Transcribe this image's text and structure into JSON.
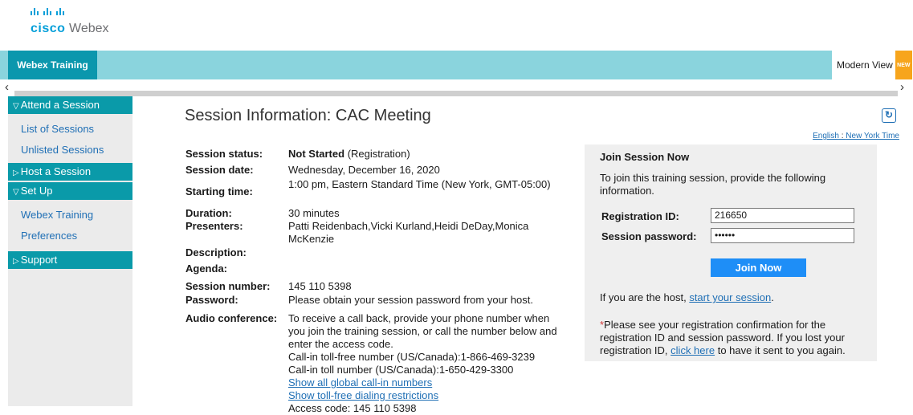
{
  "brand": {
    "cisco": "cisco",
    "webex": "Webex"
  },
  "topbar": {
    "tab": "Webex Training",
    "modern_view": "Modern View",
    "new_badge": "NEW"
  },
  "sidebar": {
    "attend": "Attend a Session",
    "list_sessions": "List of Sessions",
    "unlisted_sessions": "Unlisted Sessions",
    "host": "Host a Session",
    "setup": "Set Up",
    "webex_training": "Webex Training",
    "preferences": "Preferences",
    "support": "Support"
  },
  "page": {
    "title": "Session Information: CAC Meeting",
    "language": "English",
    "timezone": "New York Time"
  },
  "session": {
    "status_label": "Session status:",
    "status_value": "Not Started",
    "status_extra": "(Registration)",
    "date_label": "Session date:",
    "date_value": "Wednesday, December 16, 2020",
    "start_label": "Starting time:",
    "start_value": "1:00 pm, Eastern Standard Time (New York, GMT-05:00)",
    "duration_label": "Duration:",
    "duration_value": "30 minutes",
    "presenters_label": "Presenters:",
    "presenters_value": "Patti Reidenbach,Vicki Kurland,Heidi DeDay,Monica McKenzie",
    "description_label": "Description:",
    "agenda_label": "Agenda:",
    "number_label": "Session number:",
    "number_value": "145 110 5398",
    "password_label": "Password:",
    "password_value": "Please obtain your session password from your host.",
    "audio_label": "Audio conference:",
    "audio_text": "To receive a call back, provide your phone number when you join the training session, or call the number below and enter the access code.",
    "tollfree": "Call-in toll-free number (US/Canada):1-866-469-3239",
    "toll": "Call-in toll number (US/Canada):1-650-429-3300",
    "global_link": "Show all global call-in numbers",
    "restrictions_link": "Show toll-free dialing restrictions",
    "access_code": "Access code: 145 110 5398"
  },
  "join": {
    "title": "Join Session Now",
    "desc": "To join this training session, provide the following information.",
    "reg_label": "Registration ID:",
    "reg_value": "216650",
    "pwd_label": "Session password:",
    "pwd_value": "••••••",
    "button": "Join Now",
    "host_text": "If you are the host,",
    "host_link": "start your session",
    "note_pre": "Please see your registration confirmation for the registration ID and session password. If you lost your registration ID,",
    "note_link": "click here",
    "note_post": "to have it sent to you again."
  }
}
